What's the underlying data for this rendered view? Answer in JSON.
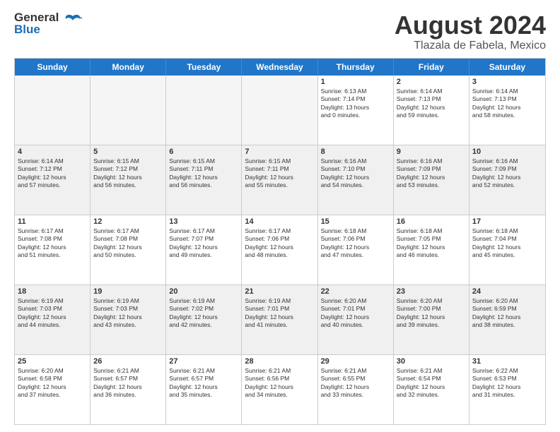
{
  "logo": {
    "line1": "General",
    "line2": "Blue"
  },
  "title": "August 2024",
  "subtitle": "Tlazala de Fabela, Mexico",
  "weekdays": [
    "Sunday",
    "Monday",
    "Tuesday",
    "Wednesday",
    "Thursday",
    "Friday",
    "Saturday"
  ],
  "rows": [
    [
      {
        "day": "",
        "info": "",
        "empty": true
      },
      {
        "day": "",
        "info": "",
        "empty": true
      },
      {
        "day": "",
        "info": "",
        "empty": true
      },
      {
        "day": "",
        "info": "",
        "empty": true
      },
      {
        "day": "1",
        "info": "Sunrise: 6:13 AM\nSunset: 7:14 PM\nDaylight: 13 hours\nand 0 minutes."
      },
      {
        "day": "2",
        "info": "Sunrise: 6:14 AM\nSunset: 7:13 PM\nDaylight: 12 hours\nand 59 minutes."
      },
      {
        "day": "3",
        "info": "Sunrise: 6:14 AM\nSunset: 7:13 PM\nDaylight: 12 hours\nand 58 minutes."
      }
    ],
    [
      {
        "day": "4",
        "info": "Sunrise: 6:14 AM\nSunset: 7:12 PM\nDaylight: 12 hours\nand 57 minutes."
      },
      {
        "day": "5",
        "info": "Sunrise: 6:15 AM\nSunset: 7:12 PM\nDaylight: 12 hours\nand 56 minutes."
      },
      {
        "day": "6",
        "info": "Sunrise: 6:15 AM\nSunset: 7:11 PM\nDaylight: 12 hours\nand 56 minutes."
      },
      {
        "day": "7",
        "info": "Sunrise: 6:15 AM\nSunset: 7:11 PM\nDaylight: 12 hours\nand 55 minutes."
      },
      {
        "day": "8",
        "info": "Sunrise: 6:16 AM\nSunset: 7:10 PM\nDaylight: 12 hours\nand 54 minutes."
      },
      {
        "day": "9",
        "info": "Sunrise: 6:16 AM\nSunset: 7:09 PM\nDaylight: 12 hours\nand 53 minutes."
      },
      {
        "day": "10",
        "info": "Sunrise: 6:16 AM\nSunset: 7:09 PM\nDaylight: 12 hours\nand 52 minutes."
      }
    ],
    [
      {
        "day": "11",
        "info": "Sunrise: 6:17 AM\nSunset: 7:08 PM\nDaylight: 12 hours\nand 51 minutes."
      },
      {
        "day": "12",
        "info": "Sunrise: 6:17 AM\nSunset: 7:08 PM\nDaylight: 12 hours\nand 50 minutes."
      },
      {
        "day": "13",
        "info": "Sunrise: 6:17 AM\nSunset: 7:07 PM\nDaylight: 12 hours\nand 49 minutes."
      },
      {
        "day": "14",
        "info": "Sunrise: 6:17 AM\nSunset: 7:06 PM\nDaylight: 12 hours\nand 48 minutes."
      },
      {
        "day": "15",
        "info": "Sunrise: 6:18 AM\nSunset: 7:06 PM\nDaylight: 12 hours\nand 47 minutes."
      },
      {
        "day": "16",
        "info": "Sunrise: 6:18 AM\nSunset: 7:05 PM\nDaylight: 12 hours\nand 46 minutes."
      },
      {
        "day": "17",
        "info": "Sunrise: 6:18 AM\nSunset: 7:04 PM\nDaylight: 12 hours\nand 45 minutes."
      }
    ],
    [
      {
        "day": "18",
        "info": "Sunrise: 6:19 AM\nSunset: 7:03 PM\nDaylight: 12 hours\nand 44 minutes."
      },
      {
        "day": "19",
        "info": "Sunrise: 6:19 AM\nSunset: 7:03 PM\nDaylight: 12 hours\nand 43 minutes."
      },
      {
        "day": "20",
        "info": "Sunrise: 6:19 AM\nSunset: 7:02 PM\nDaylight: 12 hours\nand 42 minutes."
      },
      {
        "day": "21",
        "info": "Sunrise: 6:19 AM\nSunset: 7:01 PM\nDaylight: 12 hours\nand 41 minutes."
      },
      {
        "day": "22",
        "info": "Sunrise: 6:20 AM\nSunset: 7:01 PM\nDaylight: 12 hours\nand 40 minutes."
      },
      {
        "day": "23",
        "info": "Sunrise: 6:20 AM\nSunset: 7:00 PM\nDaylight: 12 hours\nand 39 minutes."
      },
      {
        "day": "24",
        "info": "Sunrise: 6:20 AM\nSunset: 6:59 PM\nDaylight: 12 hours\nand 38 minutes."
      }
    ],
    [
      {
        "day": "25",
        "info": "Sunrise: 6:20 AM\nSunset: 6:58 PM\nDaylight: 12 hours\nand 37 minutes."
      },
      {
        "day": "26",
        "info": "Sunrise: 6:21 AM\nSunset: 6:57 PM\nDaylight: 12 hours\nand 36 minutes."
      },
      {
        "day": "27",
        "info": "Sunrise: 6:21 AM\nSunset: 6:57 PM\nDaylight: 12 hours\nand 35 minutes."
      },
      {
        "day": "28",
        "info": "Sunrise: 6:21 AM\nSunset: 6:56 PM\nDaylight: 12 hours\nand 34 minutes."
      },
      {
        "day": "29",
        "info": "Sunrise: 6:21 AM\nSunset: 6:55 PM\nDaylight: 12 hours\nand 33 minutes."
      },
      {
        "day": "30",
        "info": "Sunrise: 6:21 AM\nSunset: 6:54 PM\nDaylight: 12 hours\nand 32 minutes."
      },
      {
        "day": "31",
        "info": "Sunrise: 6:22 AM\nSunset: 6:53 PM\nDaylight: 12 hours\nand 31 minutes."
      }
    ]
  ]
}
